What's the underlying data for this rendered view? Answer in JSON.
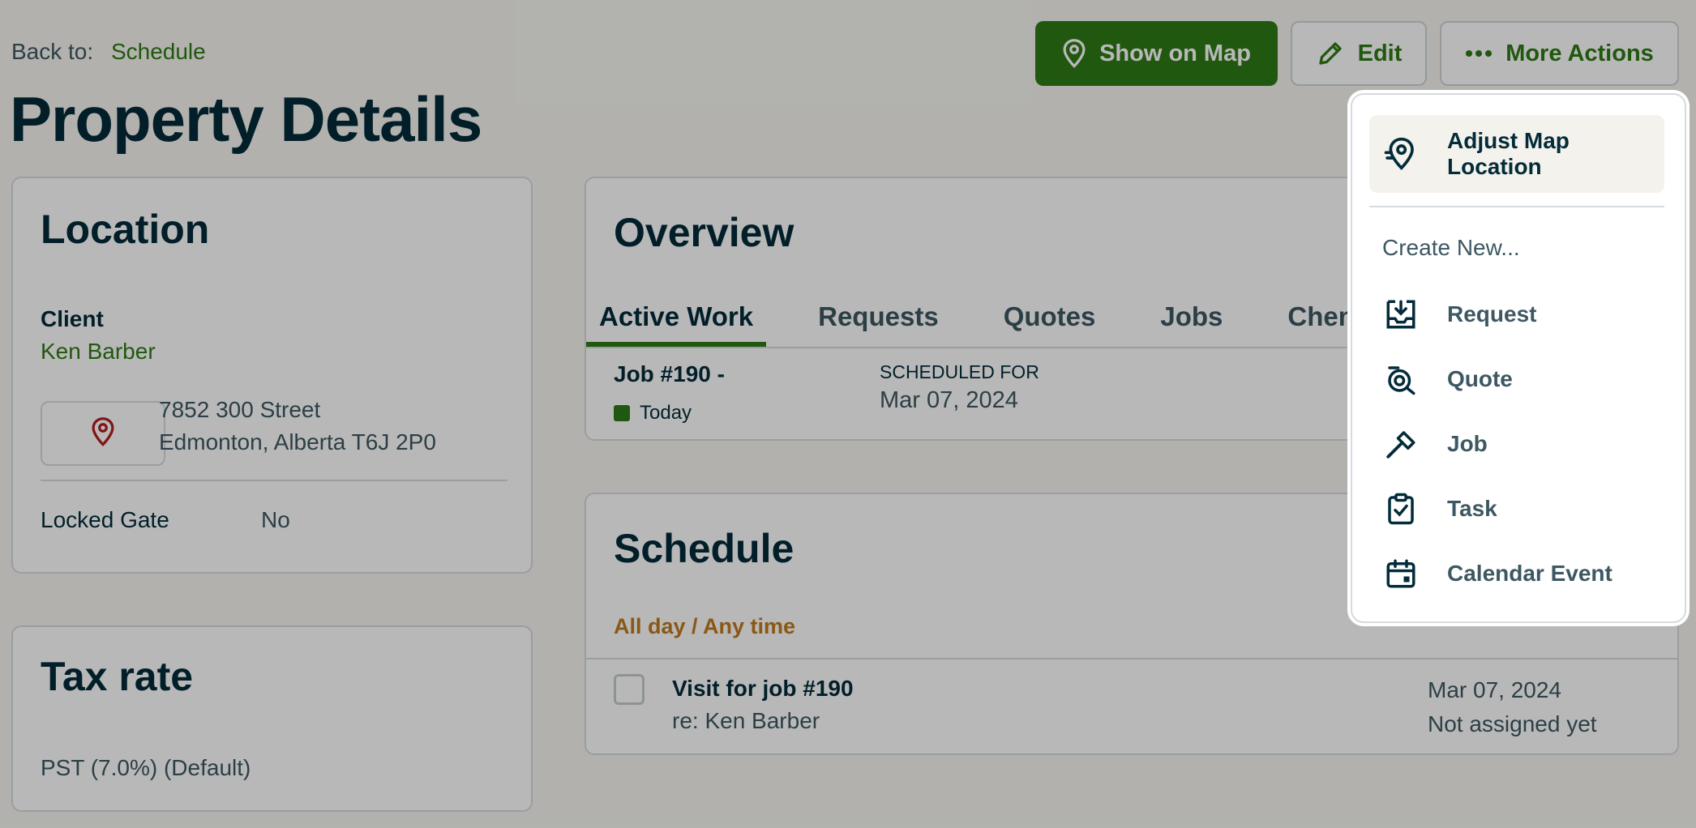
{
  "header": {
    "back_label": "Back to:",
    "back_link": "Schedule",
    "title": "Property Details",
    "buttons": {
      "show_on_map": "Show on Map",
      "edit": "Edit",
      "more_actions": "More Actions"
    }
  },
  "location": {
    "title": "Location",
    "client_label": "Client",
    "client_name": "Ken Barber",
    "address_line1": "7852 300 Street",
    "address_line2": "Edmonton, Alberta T6J 2P0",
    "locked_gate_label": "Locked Gate",
    "locked_gate_value": "No"
  },
  "tax": {
    "title": "Tax rate",
    "value": "PST (7.0%) (Default)"
  },
  "overview": {
    "title": "Overview",
    "tabs": [
      "Active Work",
      "Requests",
      "Quotes",
      "Jobs",
      "Chem"
    ],
    "job": {
      "number": "Job #190 -",
      "status": "Today",
      "scheduled_label": "SCHEDULED FOR",
      "scheduled_date": "Mar 07, 2024"
    }
  },
  "schedule": {
    "title": "Schedule",
    "anytime_label": "All day / Any time",
    "visit": {
      "title": "Visit for job #190",
      "re": "re: Ken Barber",
      "date": "Mar 07, 2024",
      "assignment": "Not assigned yet"
    }
  },
  "dropdown": {
    "adjust_map": "Adjust Map Location",
    "create_new": "Create New...",
    "items": [
      "Request",
      "Quote",
      "Job",
      "Task",
      "Calendar Event"
    ]
  },
  "colors": {
    "brand_green": "#2f7a16",
    "heading": "#032b3a",
    "warning": "#c07a1c",
    "pin_red": "#b01e1e"
  },
  "icons": {
    "map_pin": "map-pin-icon",
    "edit": "pencil-icon",
    "more": "ellipsis-icon",
    "adjust": "map-pin-adjust-icon",
    "request": "inbox-download-icon",
    "quote": "quote-calculator-icon",
    "job": "hammer-icon",
    "task": "clipboard-check-icon",
    "calendar": "calendar-icon"
  }
}
